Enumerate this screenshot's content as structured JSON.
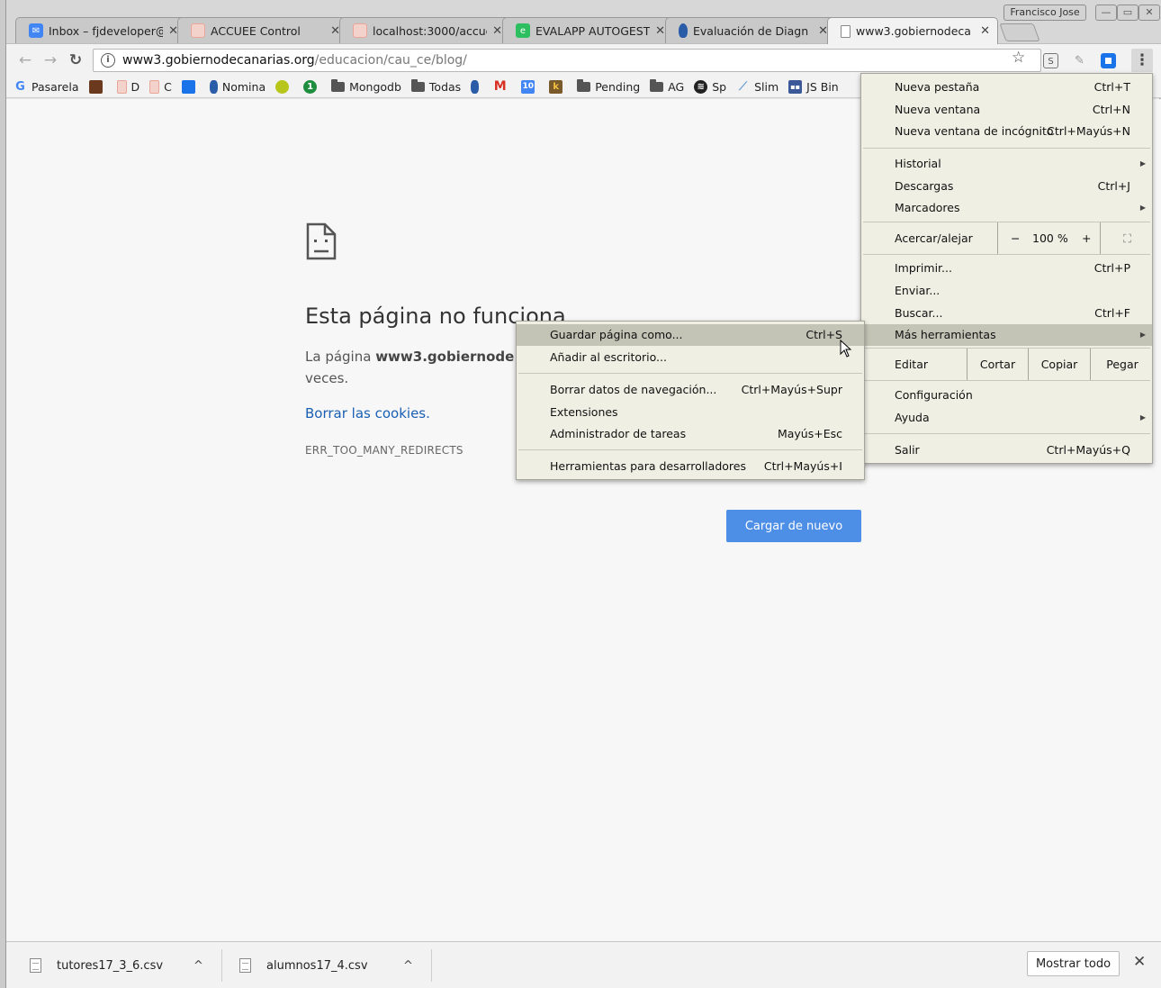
{
  "window": {
    "profile": "Francisco Jose",
    "minimize_icon": "minimize-icon",
    "maximize_icon": "maximize-icon",
    "close_icon": "close-icon"
  },
  "tabs": [
    {
      "label": "Inbox – fjdeveloper@",
      "favicon": "inbox-icon",
      "color": "#4285f4"
    },
    {
      "label": "ACCUEE Control",
      "favicon": "page-icon",
      "color": "#e8a598"
    },
    {
      "label": "localhost:3000/accue",
      "favicon": "page-icon",
      "color": "#e8a598"
    },
    {
      "label": "EVALAPP AUTOGEST",
      "favicon": "evernote-icon",
      "color": "#2dbe60"
    },
    {
      "label": "Evaluación de Diagn",
      "favicon": "canarias-icon",
      "color": "#2a5ca8"
    },
    {
      "label": "www3.gobiernodeca",
      "favicon": "document-icon",
      "color": "#888888"
    }
  ],
  "toolbar": {
    "url_host": "www3.gobiernodecanarias.org",
    "url_path": "/educacion/cau_ce/blog/",
    "back_icon": "back-arrow-icon",
    "forward_icon": "forward-arrow-icon",
    "reload_icon": "reload-icon",
    "info_icon": "info-icon",
    "star_icon": "star-icon",
    "menu_icon": "kebab-menu-icon"
  },
  "bookmarks": [
    {
      "label": "Pasarela",
      "kind": "google"
    },
    {
      "label": "",
      "kind": "img"
    },
    {
      "label": "D",
      "kind": "page"
    },
    {
      "label": "C",
      "kind": "page"
    },
    {
      "label": "",
      "kind": "blue"
    },
    {
      "label": "Nomina",
      "kind": "canarias"
    },
    {
      "label": "",
      "kind": "tennis"
    },
    {
      "label": "",
      "kind": "green1"
    },
    {
      "label": "Mongodb",
      "kind": "folder"
    },
    {
      "label": "Todas",
      "kind": "folder"
    },
    {
      "label": "",
      "kind": "canarias"
    },
    {
      "label": "",
      "kind": "gmail"
    },
    {
      "label": "",
      "kind": "cal"
    },
    {
      "label": "",
      "kind": "k"
    },
    {
      "label": "Pending",
      "kind": "folder"
    },
    {
      "label": "AG",
      "kind": "folder"
    },
    {
      "label": "Sp",
      "kind": "spotify"
    },
    {
      "label": "Slim",
      "kind": "slim"
    },
    {
      "label": "JS Bin",
      "kind": "jsbin"
    }
  ],
  "error_page": {
    "title": "Esta página no funciona",
    "body_prefix": "La página ",
    "body_host": "www3.gobiernode",
    "body_suffix": "veces.",
    "link": "Borrar las cookies.",
    "code": "ERR_TOO_MANY_REDIRECTS",
    "reload_button": "Cargar de nuevo"
  },
  "main_menu": {
    "items": [
      {
        "label": "Nueva pestaña",
        "shortcut": "Ctrl+T"
      },
      {
        "label": "Nueva ventana",
        "shortcut": "Ctrl+N"
      },
      {
        "label": "Nueva ventana de incógnito",
        "shortcut": "Ctrl+Mayús+N"
      },
      {
        "label": "Historial",
        "shortcut": ""
      },
      {
        "label": "Descargas",
        "shortcut": "Ctrl+J"
      },
      {
        "label": "Marcadores",
        "shortcut": ""
      },
      {
        "label": "Imprimir...",
        "shortcut": "Ctrl+P"
      },
      {
        "label": "Enviar...",
        "shortcut": ""
      },
      {
        "label": "Buscar...",
        "shortcut": "Ctrl+F"
      },
      {
        "label": "Más herramientas",
        "shortcut": ""
      },
      {
        "label": "Configuración",
        "shortcut": ""
      },
      {
        "label": "Ayuda",
        "shortcut": ""
      },
      {
        "label": "Salir",
        "shortcut": "Ctrl+Mayús+Q"
      }
    ],
    "zoom": {
      "label": "Acercar/alejar",
      "minus": "−",
      "value": "100 %",
      "plus": "+"
    },
    "edit": {
      "label": "Editar",
      "cut": "Cortar",
      "copy": "Copiar",
      "paste": "Pegar"
    }
  },
  "submenu": {
    "items": [
      {
        "label": "Guardar página como...",
        "shortcut": "Ctrl+S"
      },
      {
        "label": "Añadir al escritorio...",
        "shortcut": ""
      },
      {
        "label": "Borrar datos de navegación...",
        "shortcut": "Ctrl+Mayús+Supr"
      },
      {
        "label": "Extensiones",
        "shortcut": ""
      },
      {
        "label": "Administrador de tareas",
        "shortcut": "Mayús+Esc"
      },
      {
        "label": "Herramientas para desarrolladores",
        "shortcut": "Ctrl+Mayús+I"
      }
    ]
  },
  "downloads": {
    "files": [
      "tutores17_3_6.csv",
      "alumnos17_4.csv"
    ],
    "show_all": "Mostrar todo"
  }
}
